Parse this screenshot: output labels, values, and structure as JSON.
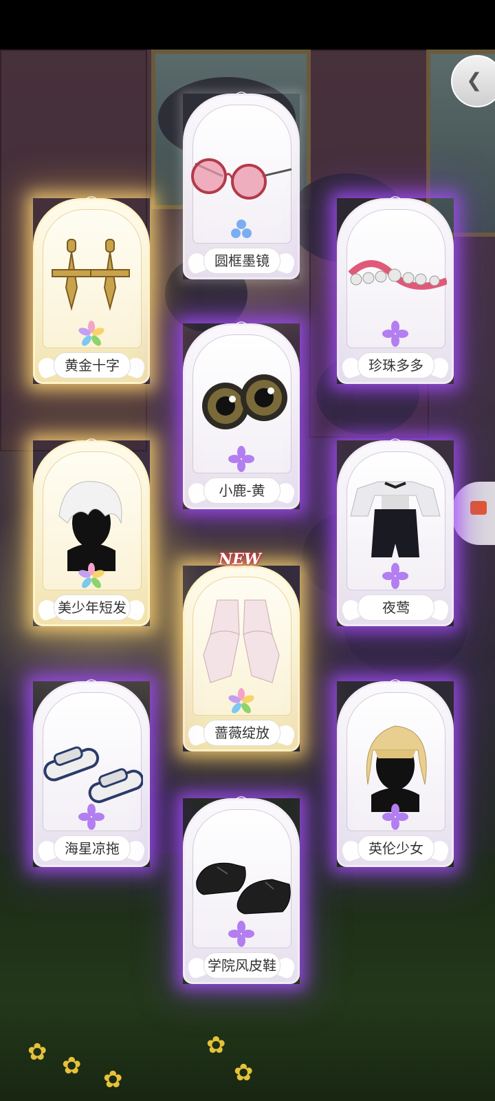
{
  "items": [
    {
      "name": "圆框墨镜",
      "rarity": "white",
      "is_new": false
    },
    {
      "name": "黄金十字",
      "rarity": "gold",
      "is_new": false
    },
    {
      "name": "珍珠多多",
      "rarity": "purple",
      "is_new": false
    },
    {
      "name": "小鹿-黄",
      "rarity": "purple",
      "is_new": false
    },
    {
      "name": "美少年短发",
      "rarity": "gold",
      "is_new": false
    },
    {
      "name": "夜莺",
      "rarity": "purple",
      "is_new": false
    },
    {
      "name": "蔷薇绽放",
      "rarity": "gold",
      "is_new": true
    },
    {
      "name": "海星凉拖",
      "rarity": "purple",
      "is_new": false
    },
    {
      "name": "英伦少女",
      "rarity": "purple",
      "is_new": false
    },
    {
      "name": "学院风皮鞋",
      "rarity": "purple",
      "is_new": false
    }
  ],
  "new_label": "NEW",
  "icons": {
    "back": "back-chevron-icon",
    "side": "side-menu-icon"
  },
  "colors": {
    "purple_glow": "#aa50ff",
    "gold_glow": "#ffd778"
  }
}
